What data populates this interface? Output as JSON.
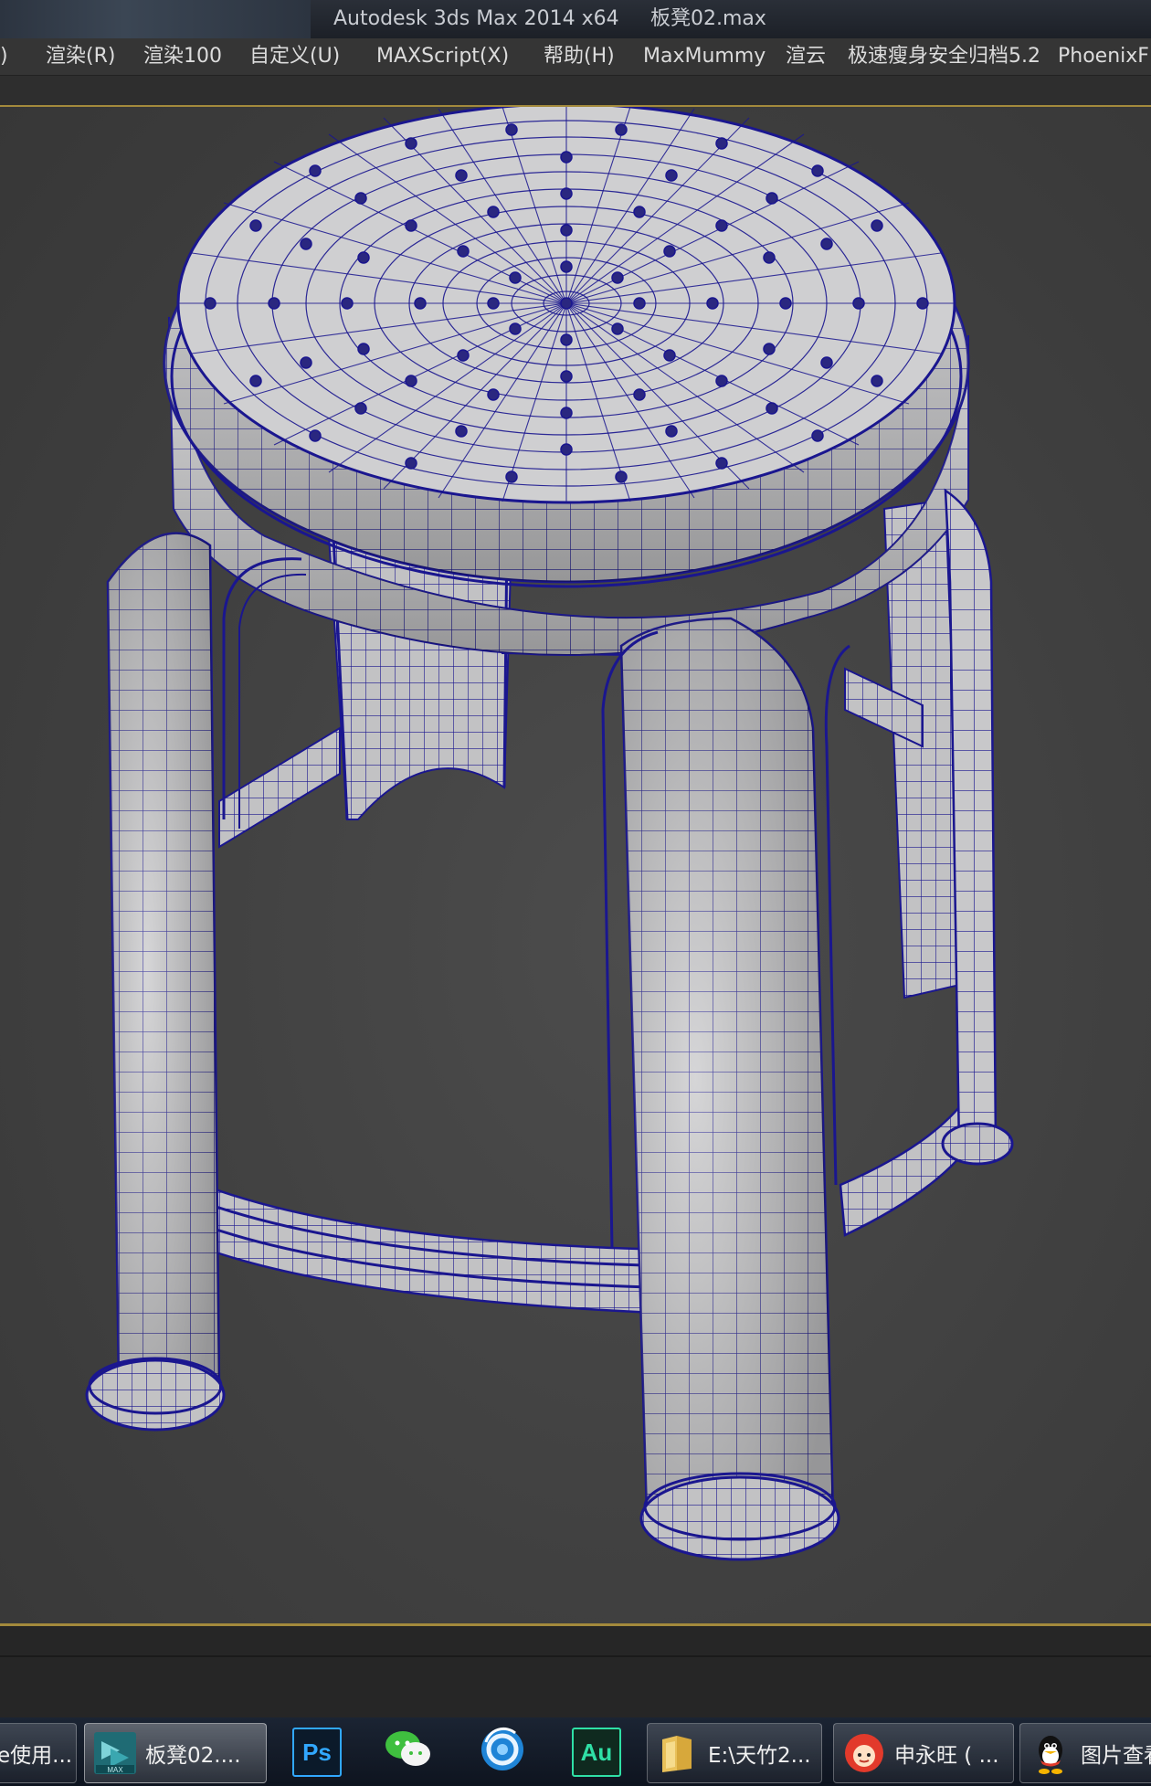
{
  "titlebar": {
    "app_title": "Autodesk 3ds Max  2014 x64",
    "file_name": "板凳02.max"
  },
  "menu": {
    "items": [
      {
        "label": ")"
      },
      {
        "label": "渲染(R)"
      },
      {
        "label": "渲染100"
      },
      {
        "label": "自定义(U)"
      },
      {
        "label": "MAXScript(X)"
      },
      {
        "label": "帮助(H)"
      },
      {
        "label": "MaxMummy"
      },
      {
        "label": "渲云"
      },
      {
        "label": "极速瘦身安全归档5.2"
      },
      {
        "label": "PhoenixFD"
      }
    ]
  },
  "viewport": {
    "model": "plastic-stool-wireframe",
    "colors": {
      "background": "#404040",
      "mesh_surface": "#c4c4c6",
      "wire": "#16148c"
    }
  },
  "taskbar": {
    "items": [
      {
        "label": "e使用...",
        "icon": "window-icon"
      },
      {
        "label": "板凳02....",
        "icon": "3dsmax-icon",
        "active": true
      },
      {
        "label": "",
        "icon": "photoshop-icon",
        "tile_text": "Ps"
      },
      {
        "label": "",
        "icon": "wechat-icon"
      },
      {
        "label": "",
        "icon": "browser-icon"
      },
      {
        "label": "",
        "icon": "audition-icon",
        "tile_text": "Au"
      },
      {
        "label": "E:\\天竹2...",
        "icon": "folder-icon"
      },
      {
        "label": "申永旺 ( ...",
        "icon": "aliwangwang-icon"
      },
      {
        "label": "图片查看",
        "icon": "qq-icon"
      }
    ]
  }
}
